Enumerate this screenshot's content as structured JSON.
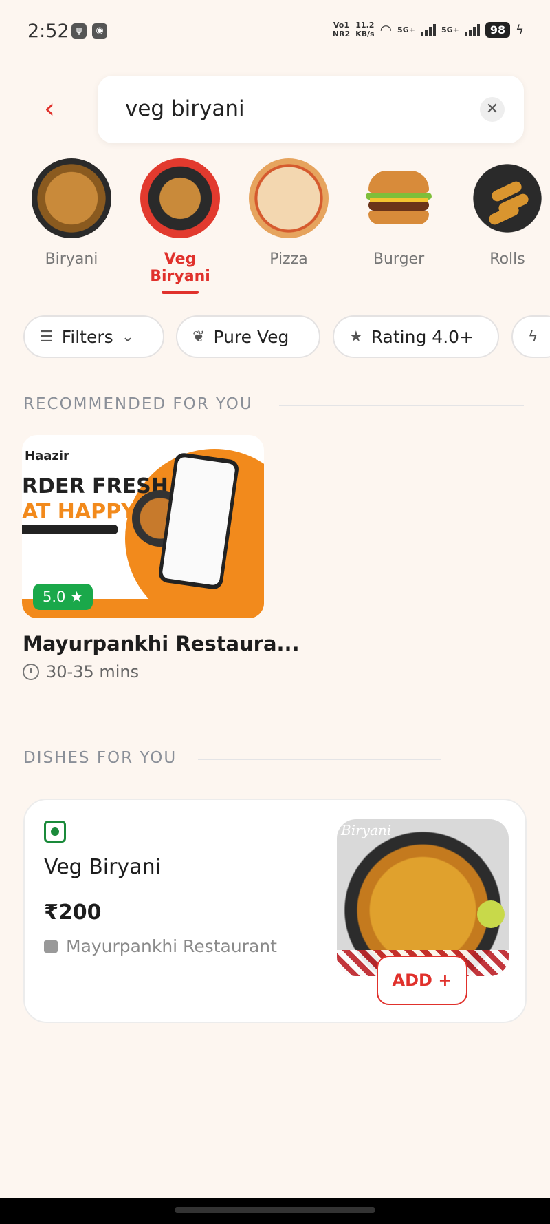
{
  "status_bar": {
    "time": "2:52",
    "net_top": "Vo1",
    "net_bottom": "NR2",
    "speed_top": "11.2",
    "speed_bottom": "KB/s",
    "sim1": "5G+",
    "sim2": "5G+",
    "battery": "98"
  },
  "search": {
    "query": "veg biryani",
    "back_icon": "chevron-left",
    "clear_icon": "close"
  },
  "categories": [
    {
      "label": "Biryani"
    },
    {
      "label": "Veg Biryani",
      "active": true
    },
    {
      "label": "Pizza"
    },
    {
      "label": "Burger"
    },
    {
      "label": "Rolls"
    }
  ],
  "filters": [
    {
      "label": "Filters",
      "icon": "sliders-icon"
    },
    {
      "label": "Pure Veg",
      "icon": "leaf-icon"
    },
    {
      "label": "Rating 4.0+",
      "icon": "star-icon"
    }
  ],
  "recommended": {
    "section_title": "RECOMMENDED FOR YOU",
    "ad_brand": "Haazir",
    "ad_line1": "RDER FRESH",
    "ad_line2": "AT HAPPY",
    "rating": "5.0 ★",
    "restaurant": "Mayurpankhi Restaura...",
    "delivery_time": "30-35 mins"
  },
  "dishes": {
    "section_title": "DISHES FOR YOU",
    "items": [
      {
        "name": "Veg Biryani",
        "price": "₹200",
        "restaurant": "Mayurpankhi Restaurant",
        "image_caption": "Biryani",
        "add_label": "ADD +"
      }
    ]
  },
  "colors": {
    "accent": "#e0312c",
    "background": "#fdf6f0",
    "rating_green": "#1aa84a",
    "veg_green": "#1a8a3a"
  }
}
